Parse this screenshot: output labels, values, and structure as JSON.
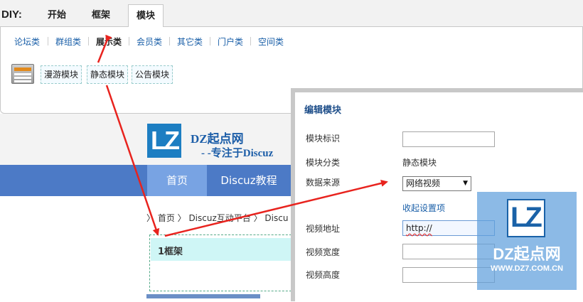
{
  "diy": {
    "label": "DIY:",
    "tabs": [
      "开始",
      "框架",
      "模块"
    ],
    "categories": [
      "论坛类",
      "群组类",
      "展示类",
      "会员类",
      "其它类",
      "门户类",
      "空间类"
    ],
    "modules": [
      "漫游模块",
      "静态模块",
      "公告模块"
    ]
  },
  "site": {
    "logo_text": "DZ起点网",
    "subtitle": "- -专注于Discuz",
    "nav": [
      "首页",
      "Discuz教程"
    ],
    "breadcrumb": "〉 首页 〉 Discuz互动平台 〉 Discu",
    "frame_label": "1框架"
  },
  "dialog": {
    "title": "编辑模块",
    "labels": {
      "id": "模块标识",
      "category": "模块分类",
      "source": "数据来源",
      "url": "视频地址",
      "width": "视频宽度",
      "height": "视频高度"
    },
    "category_value": "静态模块",
    "source_value": "网络视频",
    "collapse_link": "收起设置项",
    "url_value": "http://"
  },
  "watermark": {
    "name": "DZ起点网",
    "url": "WWW.DZ7.COM.CN"
  },
  "colors": {
    "nav_bg": "#4c7ac6",
    "arrow": "#e8231e",
    "link": "#1a5fa8"
  }
}
